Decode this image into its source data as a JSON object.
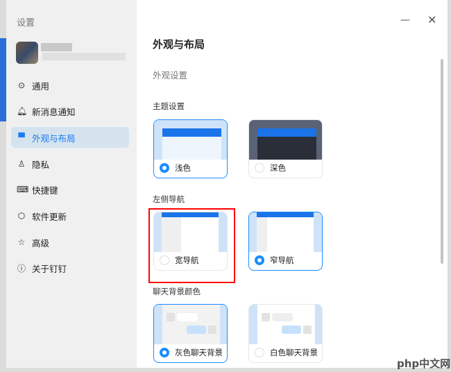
{
  "sidebar": {
    "title": "设置",
    "items": [
      {
        "label": "通用",
        "icon": "settings-icon"
      },
      {
        "label": "新消息通知",
        "icon": "bell-icon"
      },
      {
        "label": "外观与布局",
        "icon": "shirt-icon"
      },
      {
        "label": "隐私",
        "icon": "person-icon"
      },
      {
        "label": "快捷键",
        "icon": "keyboard-icon"
      },
      {
        "label": "软件更新",
        "icon": "cube-icon"
      },
      {
        "label": "高级",
        "icon": "star-icon"
      },
      {
        "label": "关于钉钉",
        "icon": "info-icon"
      }
    ]
  },
  "main": {
    "title": "外观与布局",
    "subtitle": "外观设置",
    "theme": {
      "label": "主题设置",
      "options": [
        "浅色",
        "深色"
      ]
    },
    "nav": {
      "label": "左侧导航",
      "options": [
        "宽导航",
        "窄导航"
      ]
    },
    "chatbg": {
      "label": "聊天背景颜色",
      "options": [
        "灰色聊天背景",
        "白色聊天背景"
      ]
    }
  },
  "watermark": "php中文网",
  "colors": {
    "accent": "#1a8cff",
    "highlight": "#ff0000"
  }
}
